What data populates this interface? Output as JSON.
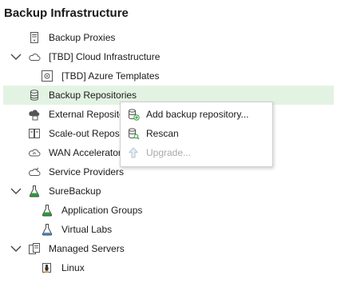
{
  "header": {
    "title": "Backup Infrastructure"
  },
  "tree": [
    {
      "id": "backup-proxies",
      "label": "Backup Proxies",
      "icon": "server-icon"
    },
    {
      "id": "cloud-infrastructure",
      "label": "[TBD] Cloud Infrastructure",
      "icon": "cloud-icon",
      "expanded": true
    },
    {
      "id": "azure-templates",
      "label": "[TBD] Azure Templates",
      "icon": "template-icon"
    },
    {
      "id": "backup-repositories",
      "label": "Backup Repositories",
      "icon": "database-icon",
      "selected": true
    },
    {
      "id": "external-repositories",
      "label": "External Reposito",
      "icon": "cloud-storage-icon"
    },
    {
      "id": "scale-out-repositories",
      "label": "Scale-out Reposi",
      "icon": "scale-out-icon"
    },
    {
      "id": "wan-accelerators",
      "label": "WAN Accelerator",
      "icon": "wan-icon"
    },
    {
      "id": "service-providers",
      "label": "Service Providers",
      "icon": "service-provider-icon"
    },
    {
      "id": "surebackup",
      "label": "SureBackup",
      "icon": "flask-icon",
      "expanded": true
    },
    {
      "id": "application-groups",
      "label": "Application Groups",
      "icon": "flask-icon"
    },
    {
      "id": "virtual-labs",
      "label": "Virtual Labs",
      "icon": "lab-icon"
    },
    {
      "id": "managed-servers",
      "label": "Managed Servers",
      "icon": "servers-icon",
      "expanded": true
    },
    {
      "id": "linux",
      "label": "Linux",
      "icon": "linux-icon"
    }
  ],
  "context_menu": {
    "items": [
      {
        "label": "Add backup repository...",
        "icon": "add-repository-icon",
        "enabled": true
      },
      {
        "label": "Rescan",
        "icon": "rescan-icon",
        "enabled": true
      },
      {
        "label": "Upgrade...",
        "icon": "upgrade-icon",
        "enabled": false
      }
    ]
  },
  "colors": {
    "selection": "#e3f3e3",
    "accent_green": "#2e9c3c",
    "disabled_text": "#a8a8a8"
  }
}
